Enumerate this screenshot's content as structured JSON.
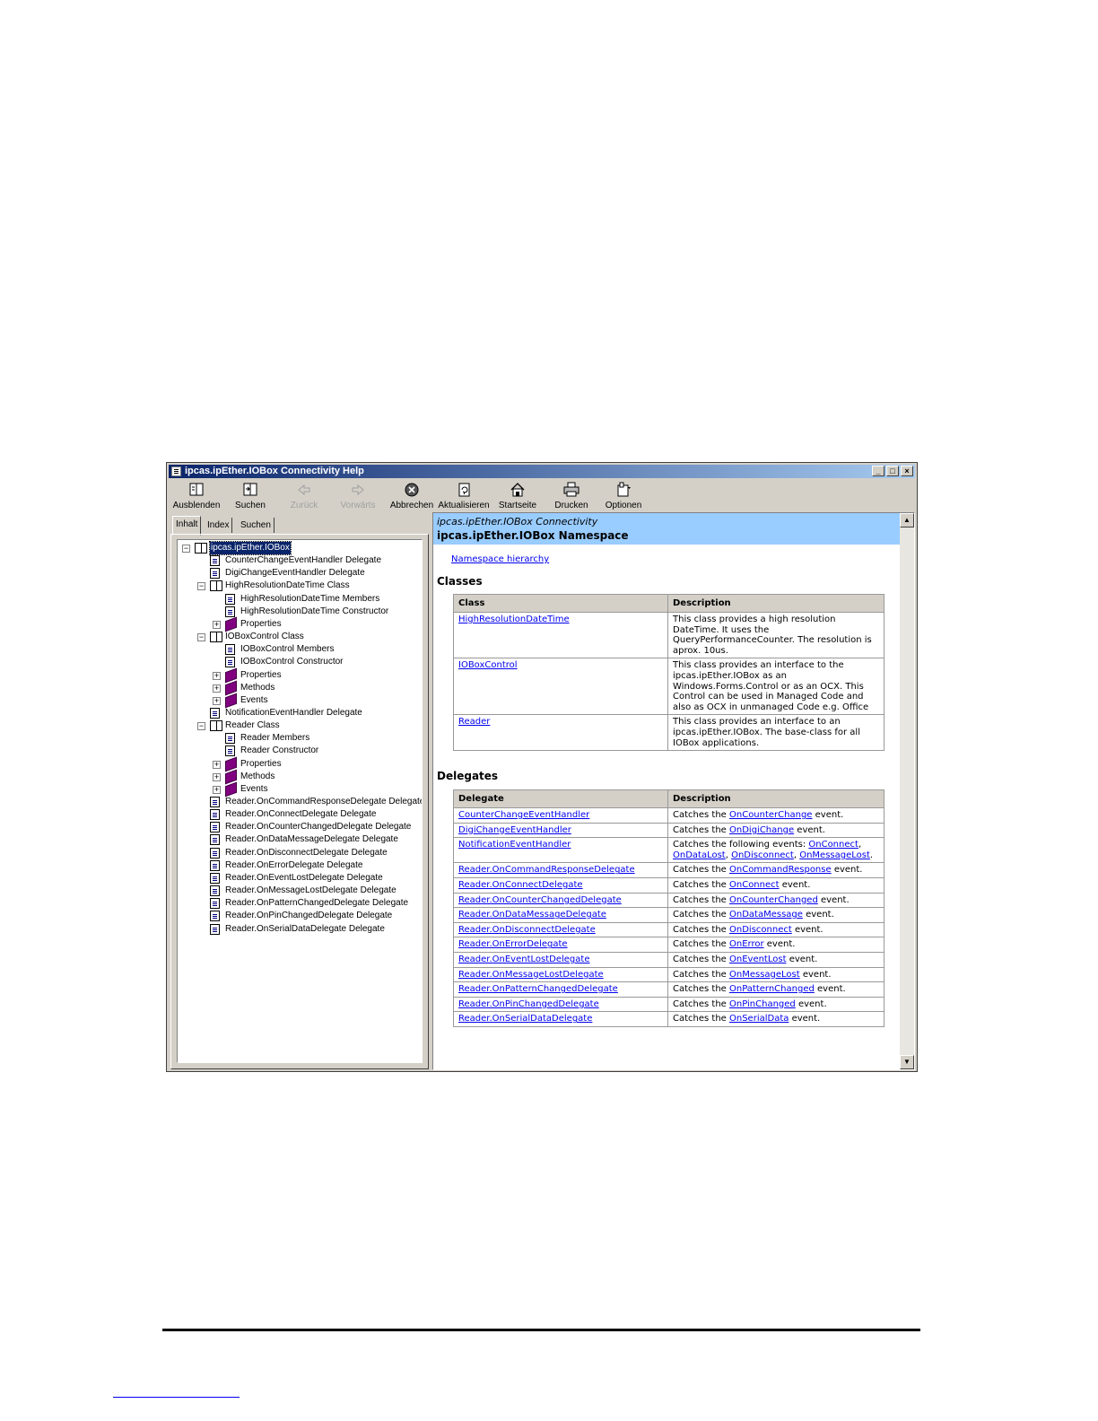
{
  "window": {
    "title": "ipcas.ipEther.IOBox Connectivity Help",
    "controls": {
      "minimize": "_",
      "maximize": "□",
      "close": "×"
    }
  },
  "toolbar": [
    {
      "label": "Ausblenden",
      "icon": "hide-pane-icon",
      "enabled": true
    },
    {
      "label": "Suchen",
      "icon": "locate-icon",
      "enabled": true
    },
    {
      "label": "Zurück",
      "icon": "back-arrow-icon",
      "enabled": false
    },
    {
      "label": "Vorwärts",
      "icon": "forward-arrow-icon",
      "enabled": false
    },
    {
      "label": "Abbrechen",
      "icon": "stop-icon",
      "enabled": true
    },
    {
      "label": "Aktualisieren",
      "icon": "refresh-icon",
      "enabled": true
    },
    {
      "label": "Startseite",
      "icon": "home-icon",
      "enabled": true
    },
    {
      "label": "Drucken",
      "icon": "print-icon",
      "enabled": true
    },
    {
      "label": "Optionen",
      "icon": "options-icon",
      "enabled": true
    }
  ],
  "tabs": [
    "Inhalt",
    "Index",
    "Suchen"
  ],
  "tree": [
    {
      "level": 0,
      "expander": "−",
      "icon": "book",
      "label": "ipcas.ipEther.IOBox",
      "selected": true
    },
    {
      "level": 1,
      "expander": "",
      "icon": "page",
      "label": "CounterChangeEventHandler Delegate"
    },
    {
      "level": 1,
      "expander": "",
      "icon": "page",
      "label": "DigiChangeEventHandler Delegate"
    },
    {
      "level": 1,
      "expander": "−",
      "icon": "book",
      "label": "HighResolutionDateTime Class"
    },
    {
      "level": 2,
      "expander": "",
      "icon": "page",
      "label": "HighResolutionDateTime Members"
    },
    {
      "level": 2,
      "expander": "",
      "icon": "page",
      "label": "HighResolutionDateTime Constructor"
    },
    {
      "level": 2,
      "expander": "+",
      "icon": "closedbook",
      "label": "Properties"
    },
    {
      "level": 1,
      "expander": "−",
      "icon": "book",
      "label": "IOBoxControl Class"
    },
    {
      "level": 2,
      "expander": "",
      "icon": "page",
      "label": "IOBoxControl Members"
    },
    {
      "level": 2,
      "expander": "",
      "icon": "page",
      "label": "IOBoxControl Constructor"
    },
    {
      "level": 2,
      "expander": "+",
      "icon": "closedbook",
      "label": "Properties"
    },
    {
      "level": 2,
      "expander": "+",
      "icon": "closedbook",
      "label": "Methods"
    },
    {
      "level": 2,
      "expander": "+",
      "icon": "closedbook",
      "label": "Events"
    },
    {
      "level": 1,
      "expander": "",
      "icon": "page",
      "label": "NotificationEventHandler Delegate"
    },
    {
      "level": 1,
      "expander": "−",
      "icon": "book",
      "label": "Reader Class"
    },
    {
      "level": 2,
      "expander": "",
      "icon": "page",
      "label": "Reader Members"
    },
    {
      "level": 2,
      "expander": "",
      "icon": "page",
      "label": "Reader Constructor"
    },
    {
      "level": 2,
      "expander": "+",
      "icon": "closedbook",
      "label": "Properties"
    },
    {
      "level": 2,
      "expander": "+",
      "icon": "closedbook",
      "label": "Methods"
    },
    {
      "level": 2,
      "expander": "+",
      "icon": "closedbook",
      "label": "Events"
    },
    {
      "level": 1,
      "expander": "",
      "icon": "page",
      "label": "Reader.OnCommandResponseDelegate Delegate"
    },
    {
      "level": 1,
      "expander": "",
      "icon": "page",
      "label": "Reader.OnConnectDelegate Delegate"
    },
    {
      "level": 1,
      "expander": "",
      "icon": "page",
      "label": "Reader.OnCounterChangedDelegate Delegate"
    },
    {
      "level": 1,
      "expander": "",
      "icon": "page",
      "label": "Reader.OnDataMessageDelegate Delegate"
    },
    {
      "level": 1,
      "expander": "",
      "icon": "page",
      "label": "Reader.OnDisconnectDelegate Delegate"
    },
    {
      "level": 1,
      "expander": "",
      "icon": "page",
      "label": "Reader.OnErrorDelegate Delegate"
    },
    {
      "level": 1,
      "expander": "",
      "icon": "page",
      "label": "Reader.OnEventLostDelegate Delegate"
    },
    {
      "level": 1,
      "expander": "",
      "icon": "page",
      "label": "Reader.OnMessageLostDelegate Delegate"
    },
    {
      "level": 1,
      "expander": "",
      "icon": "page",
      "label": "Reader.OnPatternChangedDelegate Delegate"
    },
    {
      "level": 1,
      "expander": "",
      "icon": "page",
      "label": "Reader.OnPinChangedDelegate Delegate"
    },
    {
      "level": 1,
      "expander": "",
      "icon": "page",
      "label": "Reader.OnSerialDataDelegate Delegate"
    }
  ],
  "content": {
    "header_sub": "ipcas.ipEther.IOBox Connectivity",
    "header_title": "ipcas.ipEther.IOBox Namespace",
    "namespace_link": "Namespace hierarchy",
    "classes_heading": "Classes",
    "classes_columns": [
      "Class",
      "Description"
    ],
    "classes": [
      {
        "name": "HighResolutionDateTime",
        "lines": [
          "This class provides a high resolution",
          "DateTime. It uses the",
          "QueryPerformanceCounter. The resolution is",
          "aprox. 10us."
        ]
      },
      {
        "name": "IOBoxControl",
        "lines": [
          "This class provides an interface to the",
          "ipcas.ipEther.IOBox as an",
          "Windows.Forms.Control or as an OCX. This",
          "Control can be used in Managed Code and",
          "also as OCX in unmanaged Code e.g. Office"
        ]
      },
      {
        "name": "Reader",
        "lines": [
          "This class provides an interface to an",
          "ipcas.ipEther.IOBox. The base-class for all",
          "IOBox applications."
        ]
      }
    ],
    "delegates_heading": "Delegates",
    "delegates_columns": [
      "Delegate",
      "Description"
    ],
    "delegates": [
      {
        "name": "CounterChangeEventHandler",
        "prefix": "Catches the ",
        "event": "OnCounterChange",
        "suffix": " event."
      },
      {
        "name": "DigiChangeEventHandler",
        "prefix": "Catches the ",
        "event": "OnDigiChange",
        "suffix": " event."
      },
      {
        "name": "NotificationEventHandler",
        "multi": true,
        "prefix": "Catches the following events: ",
        "events": [
          "OnConnect",
          "OnDataLost",
          "OnDisconnect",
          "OnMessageLost"
        ]
      },
      {
        "name": "Reader.OnCommandResponseDelegate",
        "prefix": "Catches the ",
        "event": "OnCommandResponse",
        "suffix": " event."
      },
      {
        "name": "Reader.OnConnectDelegate",
        "prefix": "Catches the ",
        "event": "OnConnect",
        "suffix": " event."
      },
      {
        "name": "Reader.OnCounterChangedDelegate",
        "prefix": "Catches the ",
        "event": "OnCounterChanged",
        "suffix": " event."
      },
      {
        "name": "Reader.OnDataMessageDelegate",
        "prefix": "Catches the ",
        "event": "OnDataMessage",
        "suffix": " event."
      },
      {
        "name": "Reader.OnDisconnectDelegate",
        "prefix": "Catches the ",
        "event": "OnDisconnect",
        "suffix": " event."
      },
      {
        "name": "Reader.OnErrorDelegate",
        "prefix": "Catches the ",
        "event": "OnError",
        "suffix": " event."
      },
      {
        "name": "Reader.OnEventLostDelegate",
        "prefix": "Catches the ",
        "event": "OnEventLost",
        "suffix": " event."
      },
      {
        "name": "Reader.OnMessageLostDelegate",
        "prefix": "Catches the ",
        "event": "OnMessageLost",
        "suffix": " event."
      },
      {
        "name": "Reader.OnPatternChangedDelegate",
        "prefix": "Catches the ",
        "event": "OnPatternChanged",
        "suffix": " event."
      },
      {
        "name": "Reader.OnPinChangedDelegate",
        "prefix": "Catches the ",
        "event": "OnPinChanged",
        "suffix": " event."
      },
      {
        "name": "Reader.OnSerialDataDelegate",
        "prefix": "Catches the ",
        "event": "OnSerialData",
        "suffix": " event."
      }
    ]
  },
  "scrollbar": {
    "up": "▲",
    "down": "▼"
  },
  "colors": {
    "titlebar": "#0a246a",
    "content_header": "#99ccff",
    "link": "#0000ee",
    "chrome": "#d4d0c8"
  }
}
